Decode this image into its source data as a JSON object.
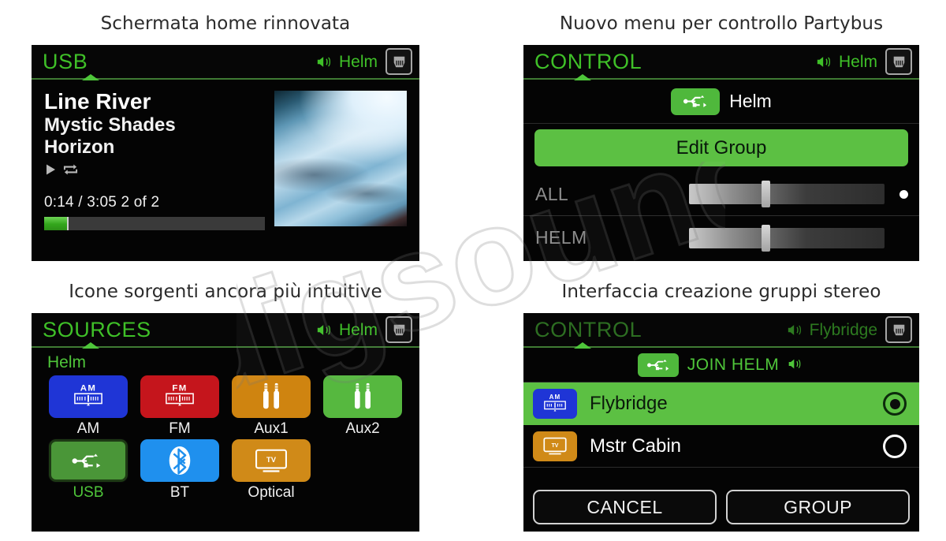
{
  "captions": {
    "top_left": "Schermata home rinnovata",
    "top_right": "Nuovo menu per controllo Partybus",
    "bottom_left": "Icone sorgenti ancora più intuitive",
    "bottom_right": "Interfaccia creazione gruppi stereo"
  },
  "watermark": {
    "text": "digsound"
  },
  "colors": {
    "accent_green": "#4fc63a",
    "button_green": "#5cc043",
    "screen_black": "#040404",
    "am_blue": "#1f35d6",
    "fm_red": "#c5151c",
    "aux1_orange": "#cf8410",
    "aux2_green": "#56b83f",
    "usb_green": "#4a9638",
    "bt_blue": "#1f90ee",
    "optical_orange": "#d08a18"
  },
  "usb_screen": {
    "header": {
      "title": "USB",
      "zone": "Helm",
      "speaker_icon": "speaker-icon",
      "network_icon": "rj45-icon"
    },
    "now_playing": {
      "track": "Line River",
      "artist": "Mystic Shades",
      "album": "Horizon",
      "play_icon": "play-icon",
      "repeat_icon": "repeat-icon",
      "time": "0:14 / 3:05  2 of 2",
      "elapsed": "0:14",
      "duration": "3:05",
      "track_position": "2 of 2",
      "progress_percent": 11
    }
  },
  "control_screen": {
    "header": {
      "title": "CONTROL",
      "zone": "Helm",
      "speaker_icon": "speaker-icon",
      "network_icon": "rj45-icon"
    },
    "source_badge_icon": "usb-icon",
    "source_label": "Helm",
    "edit_group_label": "Edit Group",
    "volumes": [
      {
        "label": "ALL",
        "value": 37
      },
      {
        "label": "HELM",
        "value": 37
      }
    ]
  },
  "sources_screen": {
    "header": {
      "title": "SOURCES",
      "zone": "Helm",
      "speaker_icon": "speaker-icon",
      "network_icon": "rj45-icon"
    },
    "zone_label": "Helm",
    "items": [
      {
        "label": "AM",
        "icon": "am-radio-icon",
        "selected": false
      },
      {
        "label": "FM",
        "icon": "fm-radio-icon",
        "selected": false
      },
      {
        "label": "Aux1",
        "icon": "aux-jack-icon",
        "selected": false
      },
      {
        "label": "Aux2",
        "icon": "aux-jack-icon",
        "selected": false
      },
      {
        "label": "USB",
        "icon": "usb-icon",
        "selected": true
      },
      {
        "label": "BT",
        "icon": "bluetooth-icon",
        "selected": false
      },
      {
        "label": "Optical",
        "icon": "tv-icon",
        "selected": false
      }
    ]
  },
  "group_screen": {
    "header": {
      "title": "CONTROL",
      "zone": "Flybridge",
      "speaker_icon": "speaker-icon",
      "network_icon": "rj45-icon"
    },
    "join_badge_icon": "usb-icon",
    "join_label": "JOIN HELM",
    "join_speaker_icon": "speaker-icon",
    "zones": [
      {
        "label": "Flybridge",
        "icon": "am-radio-icon",
        "selected": true
      },
      {
        "label": "Mstr Cabin",
        "icon": "tv-icon",
        "selected": false
      }
    ],
    "cancel_label": "CANCEL",
    "group_label": "GROUP"
  }
}
